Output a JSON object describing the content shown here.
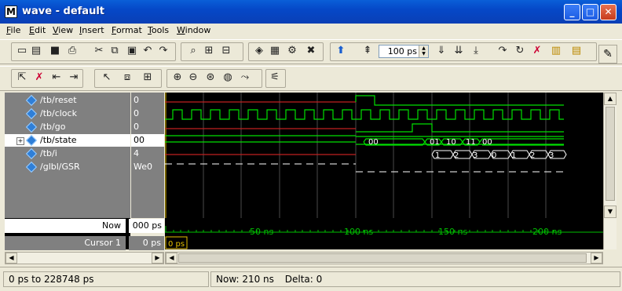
{
  "window": {
    "title": "wave - default",
    "min": "_",
    "max": "□",
    "close": "✕"
  },
  "menu": [
    "File",
    "Edit",
    "View",
    "Insert",
    "Format",
    "Tools",
    "Window"
  ],
  "toolbar": {
    "time_step": "100 ps"
  },
  "signals": [
    {
      "name": "/tb/reset",
      "value": "0"
    },
    {
      "name": "/tb/clock",
      "value": "0"
    },
    {
      "name": "/tb/go",
      "value": "0"
    },
    {
      "name": "/tb/state",
      "value": "00"
    },
    {
      "name": "/tb/i",
      "value": "4"
    },
    {
      "name": "/glbl/GSR",
      "value": "We0"
    }
  ],
  "bottom": {
    "now_label": "Now",
    "now_value": "000 ps",
    "cursor_label": "Cursor 1",
    "cursor_value": "0 ps",
    "cursor_flag": "0 ps"
  },
  "timeline": {
    "ticks": [
      "50 ns",
      "100 ns",
      "150 ns",
      "200 ns"
    ]
  },
  "state_labels": [
    "00",
    "01",
    "10",
    "11",
    "00"
  ],
  "i_labels": [
    "1",
    "2",
    "3",
    "0",
    "1",
    "2",
    "3"
  ],
  "status": {
    "range": "0 ps to 228748 ps",
    "now": "Now: 210 ns",
    "delta": "Delta: 0"
  }
}
